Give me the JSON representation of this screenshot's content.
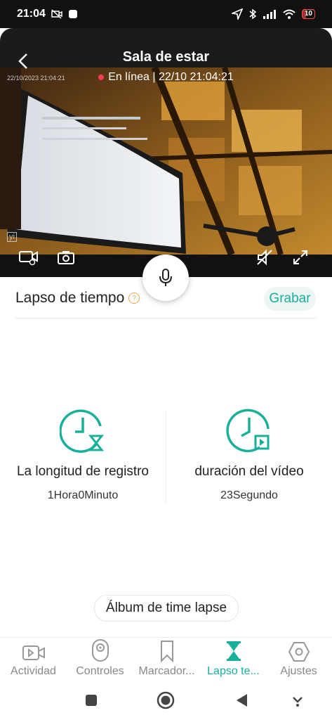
{
  "status_bar": {
    "time": "21:04",
    "battery": "10"
  },
  "header": {
    "title": "Sala de estar"
  },
  "video": {
    "online_status": "En línea | 22/10 21:04:21",
    "camera_timestamp": "22/10/2023  21:04:21",
    "camera_logo": "yi"
  },
  "section": {
    "title": "Lapso de tiempo",
    "help": "?",
    "record_label": "Grabar"
  },
  "stats": [
    {
      "label": "La longitud de registro",
      "value": "1Hora0Minuto"
    },
    {
      "label": "duración del vídeo",
      "value": "23Segundo"
    }
  ],
  "album": {
    "label": "Álbum de time lapse"
  },
  "tabs": [
    {
      "label": "Actividad",
      "icon": "video-icon"
    },
    {
      "label": "Controles",
      "icon": "camera-remote-icon"
    },
    {
      "label": "Marcador...",
      "icon": "bookmark-icon"
    },
    {
      "label": "Lapso te...",
      "icon": "hourglass-icon",
      "active": true
    },
    {
      "label": "Ajustes",
      "icon": "hexagon-settings-icon"
    }
  ],
  "colors": {
    "accent": "#18b09a",
    "online_dot": "#ff3b4f",
    "dark": "#1b1b1b"
  }
}
